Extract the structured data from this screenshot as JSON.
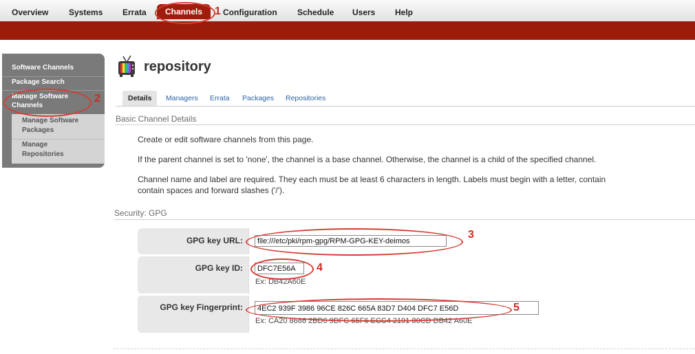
{
  "topnav": {
    "tabs": [
      "Overview",
      "Systems",
      "Errata",
      "Channels",
      "Configuration",
      "Schedule",
      "Users",
      "Help"
    ],
    "active": "Channels",
    "accent": "#9b1c0b"
  },
  "sidebar": {
    "items": [
      "Software Channels",
      "Package Search",
      "Manage Software Channels"
    ],
    "subitems": [
      "Manage Software Packages",
      "Manage Repositories"
    ]
  },
  "page": {
    "title": "repository",
    "icon": "tv-channel-icon"
  },
  "subtabs": [
    "Details",
    "Managers",
    "Errata",
    "Packages",
    "Repositories"
  ],
  "basic": {
    "heading": "Basic Channel Details",
    "p1": "Create or edit software channels from this page.",
    "p2": "If the parent channel is set to 'none', the channel is a base channel. Otherwise, the channel is a child of the specified channel.",
    "p3a": "Channel name and label are required. They each must be at least 6 characters in length. Labels must begin with a letter, contain",
    "p3b": "contain spaces and forward slashes ('/')."
  },
  "security": {
    "heading": "Security: GPG",
    "url_label": "GPG key URL:",
    "url_value": "file:///etc/pki/rpm-gpg/RPM-GPG-KEY-deimos",
    "id_label": "GPG key ID:",
    "id_value": "DFC7E56A",
    "id_hint": "Ex: DB42A60E",
    "fp_label": "GPG key Fingerprint:",
    "fp_value": "4EC2 939F 3986 96CE 826C  665A 83D7 D404 DFC7 E56D",
    "fp_hint": "Ex: CA20 8686 2BD6 9DFC 65F6 ECC4 2191 80CD DB42 A60E"
  },
  "annotations": [
    "1",
    "2",
    "3",
    "4",
    "5"
  ]
}
